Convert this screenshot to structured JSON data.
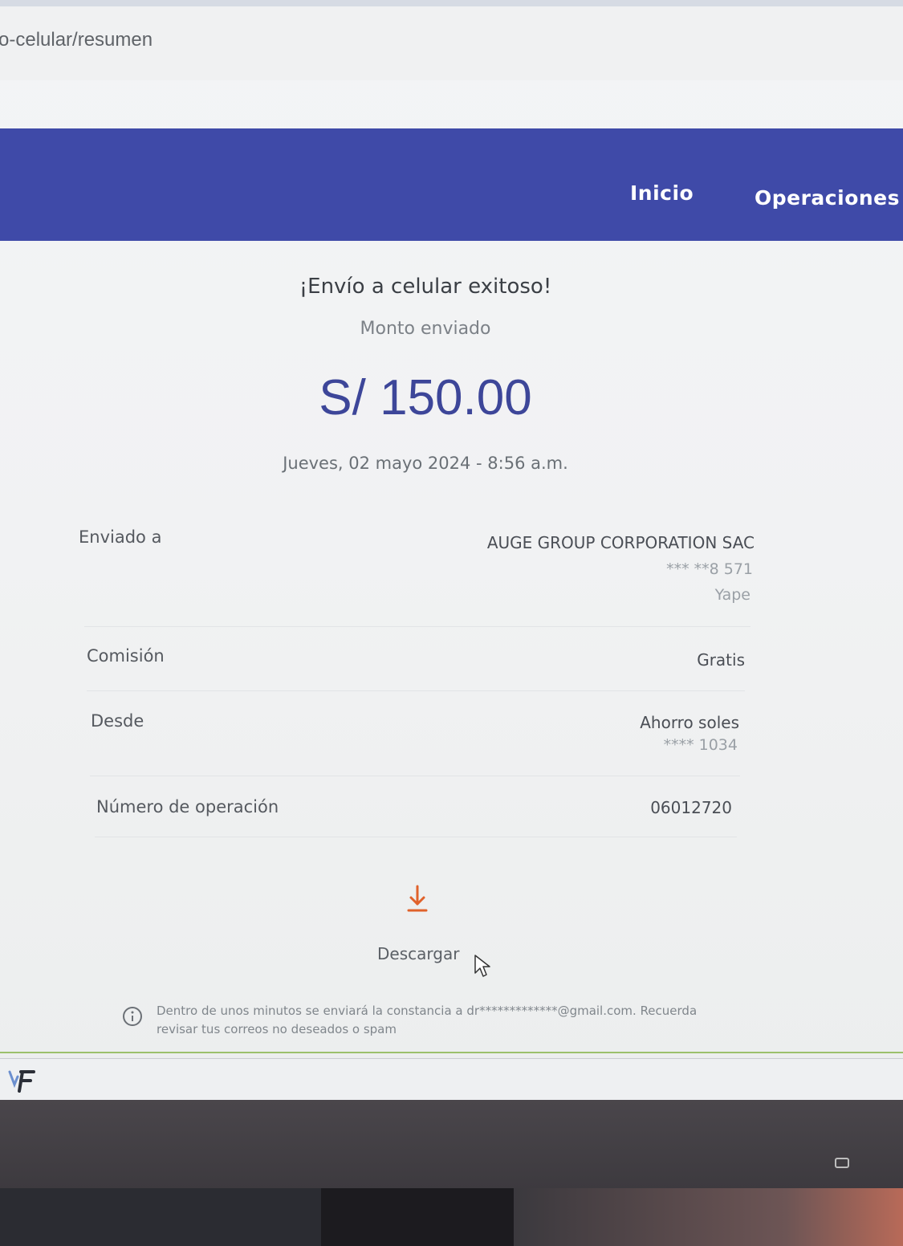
{
  "browser": {
    "url_fragment": "o-celular/resumen"
  },
  "header": {
    "nav": [
      "Inicio",
      "Operaciones"
    ]
  },
  "summary": {
    "title": "¡Envío a celular exitoso!",
    "amount_label": "Monto enviado",
    "amount": "S/ 150.00",
    "datetime": "Jueves, 02 mayo 2024 - 8:56 a.m."
  },
  "details": {
    "sent_to": {
      "label": "Enviado a",
      "name": "AUGE GROUP CORPORATION SAC",
      "phone": "*** **8 571",
      "service": "Yape"
    },
    "commission": {
      "label": "Comisión",
      "value": "Gratis"
    },
    "from": {
      "label": "Desde",
      "account": "Ahorro soles",
      "number": "**** 1034"
    },
    "operation": {
      "label": "Número de operación",
      "value": "06012720"
    }
  },
  "download": {
    "label": "Descargar",
    "icon": "download-icon",
    "color": "#e0622b"
  },
  "notice": {
    "icon": "info-icon",
    "text": "Dentro de unos minutos se enviará la constancia a dr*************@gmail.com. Recuerda revisar tus correos no deseados o spam"
  },
  "colors": {
    "header": "#3f4aa8",
    "amount": "#3d4699",
    "accent_line": "#9bc16b"
  }
}
